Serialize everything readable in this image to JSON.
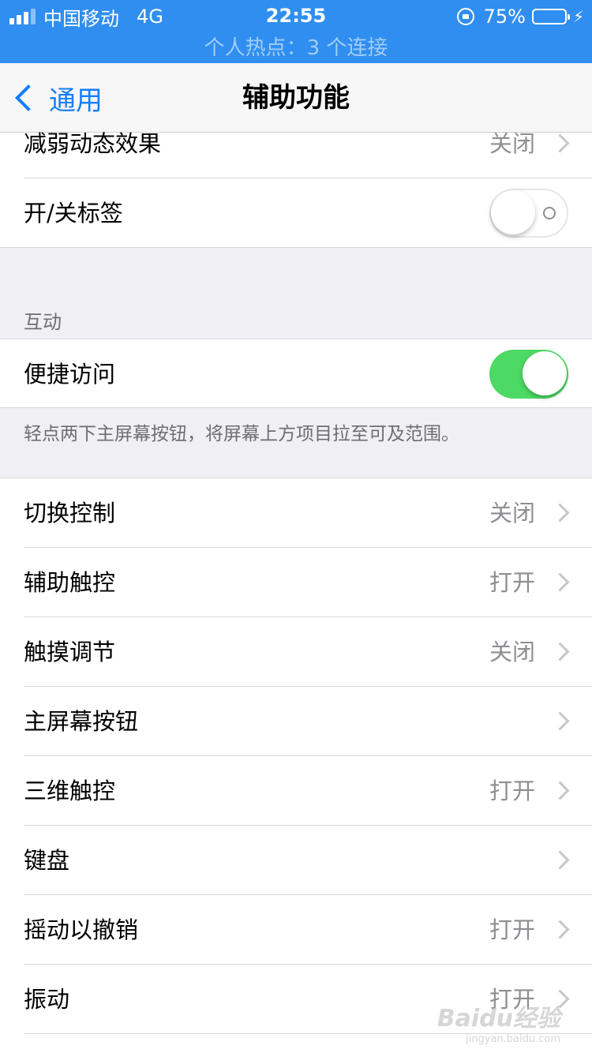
{
  "status_bar": {
    "carrier": "中国移动",
    "network": "4G",
    "time": "22:55",
    "battery": "75%",
    "hotspot": "个人热点：3 个连接",
    "battery_level_percent": 75
  },
  "nav": {
    "back_label": "通用",
    "title": "辅助功能"
  },
  "top_group": [
    {
      "label": "减弱动态效果",
      "value": "关闭"
    },
    {
      "label": "开/关标签",
      "toggle": "off"
    }
  ],
  "interaction": {
    "header": "互动",
    "reachability_label": "便捷访问",
    "reachability_toggle": "on",
    "footer": "轻点两下主屏幕按钮，将屏幕上方项目拉至可及范围。"
  },
  "list": [
    {
      "label": "切换控制",
      "value": "关闭"
    },
    {
      "label": "辅助触控",
      "value": "打开"
    },
    {
      "label": "触摸调节",
      "value": "关闭"
    },
    {
      "label": "主屏幕按钮",
      "value": ""
    },
    {
      "label": "三维触控",
      "value": "打开"
    },
    {
      "label": "键盘",
      "value": ""
    },
    {
      "label": "摇动以撤销",
      "value": "打开"
    },
    {
      "label": "振动",
      "value": "打开"
    }
  ],
  "watermark": {
    "main": "Baidu经验",
    "sub": "jingyan.baidu.com"
  },
  "colors": {
    "status_bar": "#2f8ef0",
    "accent": "#147efb",
    "toggle_on": "#4cd964",
    "background": "#efeff4"
  }
}
